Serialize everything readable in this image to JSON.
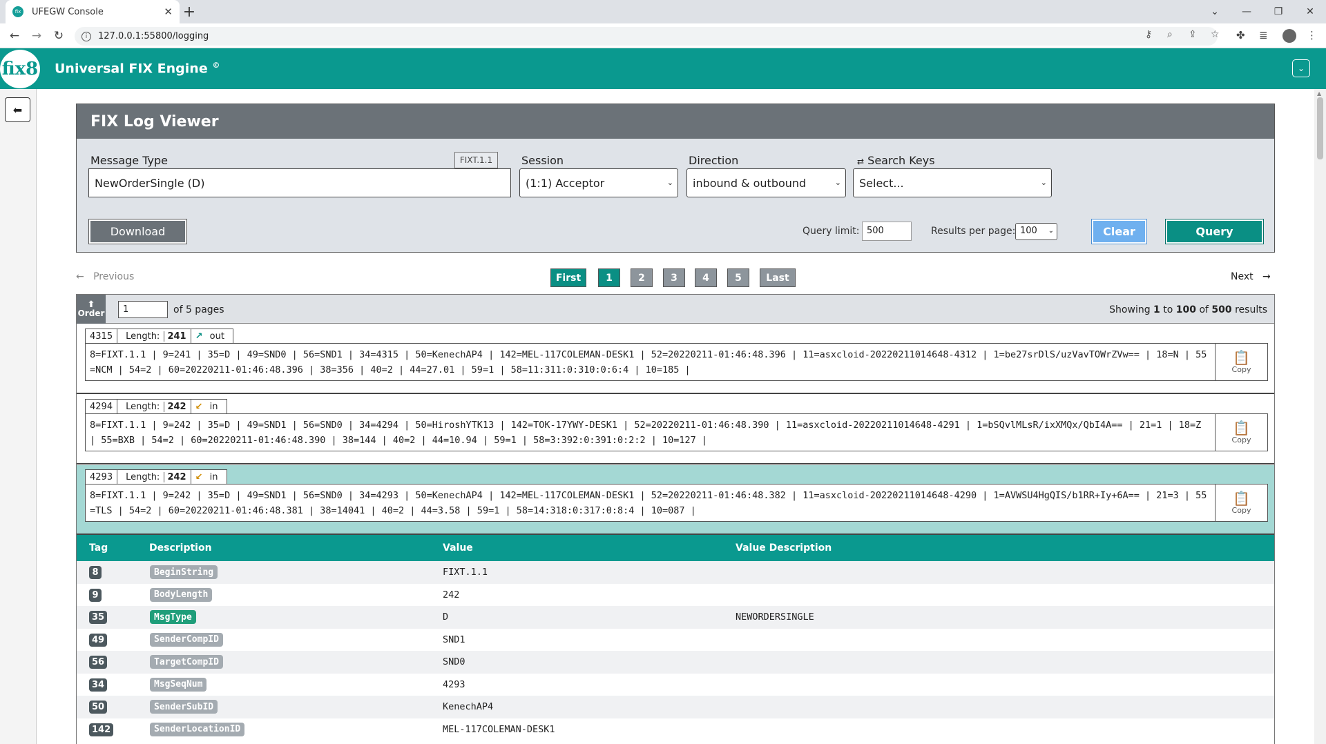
{
  "browser": {
    "tab_title": "UFEGW Console",
    "url": "127.0.0.1:55800/logging"
  },
  "app": {
    "logo_text": "fix8",
    "title": "Universal FIX Engine",
    "title_sup": "©"
  },
  "panel": {
    "title": "FIX Log Viewer",
    "message_type_label": "Message Type",
    "message_type_badge": "FIXT.1.1",
    "message_type_value": "NewOrderSingle (D)",
    "session_label": "Session",
    "session_value": "(1:1) Acceptor",
    "direction_label": "Direction",
    "direction_value": "inbound & outbound",
    "search_keys_label": "Search Keys",
    "search_keys_value": "Select...",
    "download_label": "Download",
    "query_limit_label": "Query limit:",
    "query_limit_value": "500",
    "results_per_page_label": "Results per page:",
    "results_per_page_value": "100",
    "clear_label": "Clear",
    "query_label": "Query"
  },
  "pagination": {
    "previous": "Previous",
    "next": "Next",
    "first": "First",
    "last": "Last",
    "pages": [
      "1",
      "2",
      "3",
      "4",
      "5"
    ],
    "current": "1"
  },
  "results": {
    "order_label": "Order",
    "page_input": "1",
    "of_pages": "of 5 pages",
    "showing_prefix": "Showing ",
    "showing_from": "1",
    "showing_to_word": " to ",
    "showing_to": "100",
    "showing_of_word": " of ",
    "showing_total": "500",
    "showing_suffix": " results"
  },
  "messages": [
    {
      "seq": "4315",
      "length_label": "Length:",
      "length": "241",
      "direction": "out",
      "body": "8=FIXT.1.1 | 9=241 | 35=D | 49=SND0 | 56=SND1 | 34=4315 | 50=KenechAP4 | 142=MEL-117COLEMAN-DESK1 | 52=20220211-01:46:48.396 | 11=asxcloid-20220211014648-4312 | 1=be27srDlS/uzVavTOWrZVw== | 18=N | 55=NCM | 54=2 | 60=20220211-01:46:48.396 | 38=356 | 40=2 | 44=27.01 | 59=1 | 58=11:311:0:310:0:6:4 | 10=185 |",
      "copy_label": "Copy"
    },
    {
      "seq": "4294",
      "length_label": "Length:",
      "length": "242",
      "direction": "in",
      "body": "8=FIXT.1.1 | 9=242 | 35=D | 49=SND1 | 56=SND0 | 34=4294 | 50=HiroshYTK13 | 142=TOK-17YWY-DESK1 | 52=20220211-01:46:48.390 | 11=asxcloid-20220211014648-4291 | 1=bSQvlMLsR/ixXMQx/QbI4A== | 21=1 | 18=Z | 55=BXB | 54=2 | 60=20220211-01:46:48.390 | 38=144 | 40=2 | 44=10.94 | 59=1 | 58=3:392:0:391:0:2:2 | 10=127 |",
      "copy_label": "Copy"
    },
    {
      "seq": "4293",
      "length_label": "Length:",
      "length": "242",
      "direction": "in",
      "body": "8=FIXT.1.1 | 9=242 | 35=D | 49=SND1 | 56=SND0 | 34=4293 | 50=KenechAP4 | 142=MEL-117COLEMAN-DESK1 | 52=20220211-01:46:48.382 | 11=asxcloid-20220211014648-4290 | 1=AVWSU4HgQIS/b1RR+Iy+6A== | 21=3 | 55=TLS | 54=2 | 60=20220211-01:46:48.381 | 38=14041 | 40=2 | 44=3.58 | 59=1 | 58=14:318:0:317:0:8:4 | 10=087 |",
      "copy_label": "Copy"
    }
  ],
  "tag_table": {
    "headers": {
      "tag": "Tag",
      "description": "Description",
      "value": "Value",
      "value_description": "Value Description"
    },
    "rows": [
      {
        "tag": "8",
        "description": "BeginString",
        "value": "FIXT.1.1",
        "value_description": ""
      },
      {
        "tag": "9",
        "description": "BodyLength",
        "value": "242",
        "value_description": ""
      },
      {
        "tag": "35",
        "description": "MsgType",
        "value": "D",
        "value_description": "NEWORDERSINGLE"
      },
      {
        "tag": "49",
        "description": "SenderCompID",
        "value": "SND1",
        "value_description": ""
      },
      {
        "tag": "56",
        "description": "TargetCompID",
        "value": "SND0",
        "value_description": ""
      },
      {
        "tag": "34",
        "description": "MsgSeqNum",
        "value": "4293",
        "value_description": ""
      },
      {
        "tag": "50",
        "description": "SenderSubID",
        "value": "KenechAP4",
        "value_description": ""
      },
      {
        "tag": "142",
        "description": "SenderLocationID",
        "value": "MEL-117COLEMAN-DESK1",
        "value_description": ""
      }
    ]
  },
  "colors": {
    "brand": "#0a998f",
    "header_gray": "#6b7278",
    "selected_row": "#a4d8d4",
    "clear_blue": "#6fb0ef"
  }
}
